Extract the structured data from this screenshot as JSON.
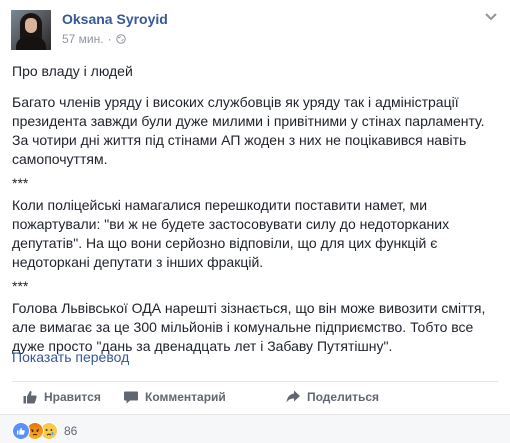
{
  "post": {
    "author": "Oksana Syroyid",
    "time": "57 мин.",
    "dot": "·",
    "paragraphs": [
      "Про владу і людей",
      "Багато членів уряду і високих службовців як уряду так і адміністрації президента завжди були дуже милими і привітними у стінах парламенту. За чотири дні життя під стінами АП жоден з них не поцікавився навіть самопочуттям.",
      "***",
      "Коли поліцейські намагалися перешкодити поставити намет, ми пожартували: \"ви ж не будете застосовувати силу до недоторканих депутатів\". На що вони серйозно відповіли, що для цих функцій є недоторкані депутати з інших фракцій.",
      "***",
      "Голова Львівської ОДА нарешті зізнається, що він може вивозити сміття, але вимагає за це 300 мільйонів і комунальне підприємство. Тобто все дуже просто \"дань за двенадцать лет і Забаву Путятішну\"."
    ],
    "translate_link": "Показать перевод"
  },
  "actions": {
    "like": "Нравится",
    "comment": "Комментарий",
    "share": "Поделиться"
  },
  "reactions": {
    "types": [
      "like-icon",
      "angry-icon",
      "sad-icon"
    ],
    "count": "86"
  },
  "colors": {
    "link": "#365899",
    "text": "#1d2129",
    "muted": "#90949c"
  }
}
